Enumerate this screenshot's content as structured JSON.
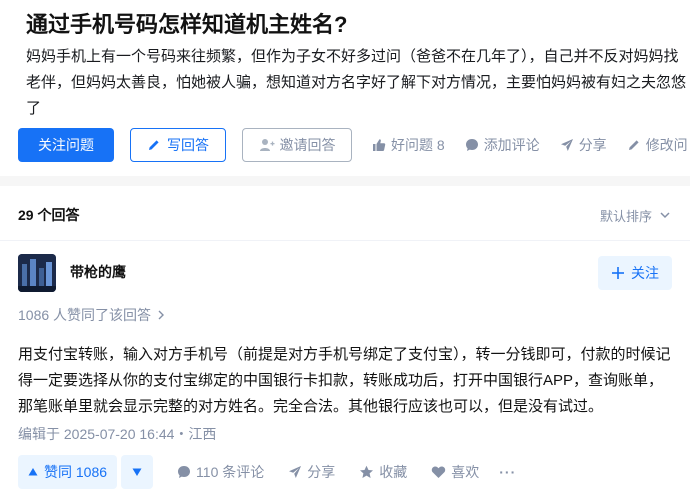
{
  "question": {
    "title": "通过手机号码怎样知道机主姓名?",
    "description": "妈妈手机上有一个号码来往频繁，但作为子女不好多过问（爸爸不在几年了），自己并不反对妈妈找老伴，但妈妈太善良，怕她被人骗，想知道对方名字好了解下对方情况，主要怕妈妈被有妇之夫忽悠了",
    "follow_label": "关注问题",
    "write_answer_label": "写回答",
    "invite_label": "邀请回答",
    "good_question_label": "好问题 8",
    "add_comment_label": "添加评论",
    "share_label": "分享",
    "edit_label": "修改问"
  },
  "answers_header": {
    "count_label": "29 个回答",
    "sort_label": "默认排序"
  },
  "answer": {
    "author_name": "带枪的鹰",
    "follow_label": "关注",
    "votes_label": "1086 人赞同了该回答",
    "content": "用支付宝转账，输入对方手机号（前提是对方手机号绑定了支付宝），转一分钱即可，付款的时候记得一定要选择从你的支付宝绑定的中国银行卡扣款，转账成功后，打开中国银行APP，查询账单，那笔账单里就会显示完整的对方姓名。完全合法。其他银行应该也可以，但是没有试过。",
    "edited_label": "编辑于 2025-07-20 16:44・江西",
    "upvote_label": "赞同 1086",
    "comments_label": "110 条评论",
    "share_label": "分享",
    "collect_label": "收藏",
    "like_label": "喜欢",
    "more_label": "···"
  }
}
